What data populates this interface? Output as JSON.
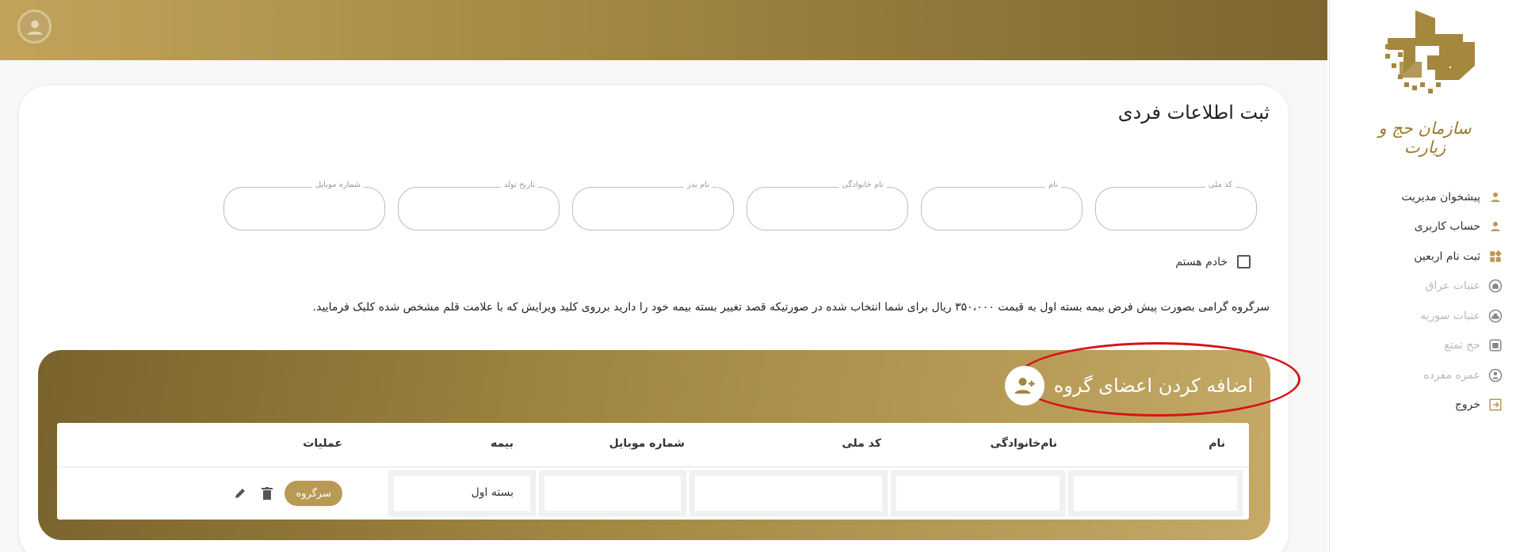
{
  "brand": {
    "org_name": "سازمان حج و زیارت",
    "logo_text": "زیارت"
  },
  "sidebar": {
    "items": [
      {
        "label": "پیشخوان مدیریت",
        "icon": "user-icon",
        "enabled": true
      },
      {
        "label": "حساب کاربری",
        "icon": "user-icon",
        "enabled": true
      },
      {
        "label": "ثبت نام اربعین",
        "icon": "grid-icon",
        "enabled": true
      },
      {
        "label": "عتبات عراق",
        "icon": "mosque-icon",
        "enabled": false
      },
      {
        "label": "عتبات سوریه",
        "icon": "mosque-icon",
        "enabled": false
      },
      {
        "label": "حج تمتع",
        "icon": "kaaba-icon",
        "enabled": false
      },
      {
        "label": "عمره مفرده",
        "icon": "umrah-icon",
        "enabled": false
      },
      {
        "label": "خروج",
        "icon": "logout-icon",
        "enabled": true
      }
    ]
  },
  "page": {
    "title": "ثبت اطلاعات فردی",
    "fields": [
      {
        "label": "کد ملی",
        "value": ""
      },
      {
        "label": "نام",
        "value": ""
      },
      {
        "label": "نام خانوادگی",
        "value": ""
      },
      {
        "label": "نام پدر",
        "value": ""
      },
      {
        "label": "تاریخ تولد",
        "value": ""
      },
      {
        "label": "شماره موبایل",
        "value": ""
      }
    ],
    "servant_checkbox_label": "خادم هستم",
    "notice": "سرگروه گرامی بصورت پیش فرض بیمه بسته اول به قیمت ۳۵۰،۰۰۰ ریال برای شما انتخاب شده در صورتیکه قصد تغییر بسته بیمه خود را دارید برروی کلید ویرایش که با علامت قلم مشخص شده کلیک فرمایید."
  },
  "group": {
    "title": "اضافه کردن اعضای گروه",
    "table": {
      "headers": [
        "نام",
        "نام‌خانوادگی",
        "کد ملی",
        "شماره موبایل",
        "بیمه",
        "عملیات"
      ],
      "rows": [
        {
          "first_name": "",
          "last_name": "",
          "national_code": "",
          "mobile": "",
          "insurance": "بسته اول",
          "role_badge": "سرگروه"
        }
      ]
    }
  },
  "colors": {
    "gold": "#b89a55",
    "gold_dark": "#7a622d",
    "highlight_red": "#d5141a"
  }
}
